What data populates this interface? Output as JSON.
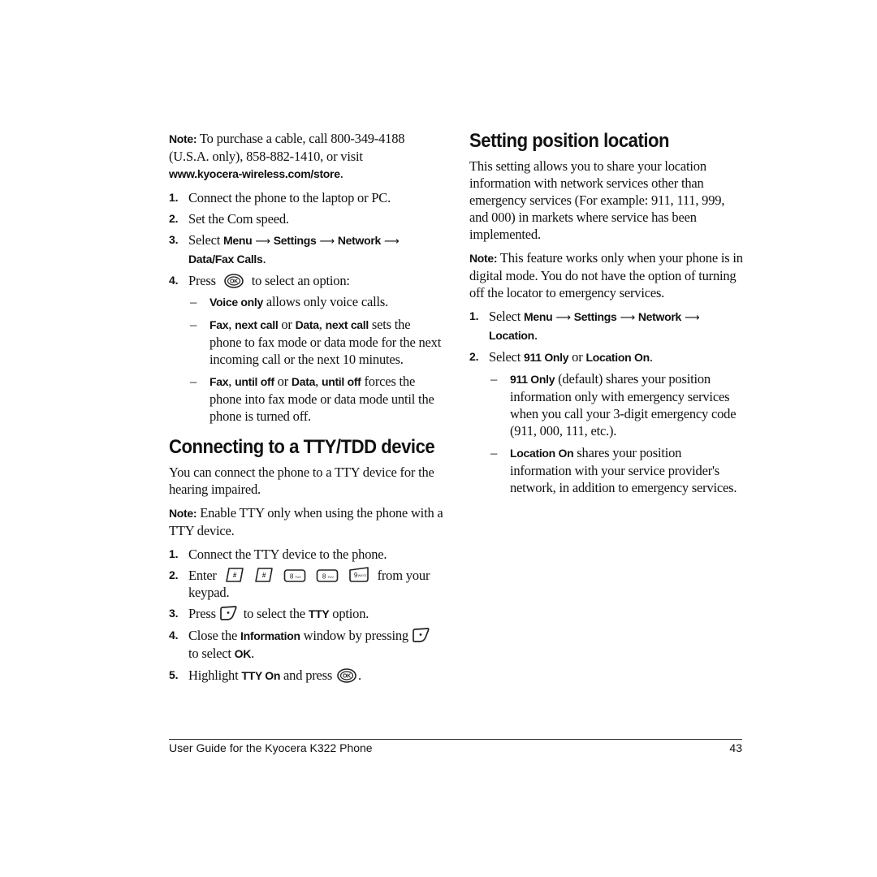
{
  "left": {
    "note1": {
      "label": "Note:",
      "text1": " To purchase a cable, call 800-349-4188 (U.S.A. only), 858-882-1410, or visit ",
      "url": "www.kyocera-wireless.com/store",
      "end": "."
    },
    "steps1": [
      {
        "num": "1.",
        "text": "Connect the phone to the laptop or PC."
      },
      {
        "num": "2.",
        "text": "Set the Com speed."
      },
      {
        "num": "3.",
        "pre": "Select ",
        "menu": "Menu",
        "settings": "Settings",
        "network": "Network",
        "last": "Data/Fax Calls",
        "end": "."
      },
      {
        "num": "4.",
        "pre": "Press ",
        "post": " to select an option:"
      }
    ],
    "options": [
      {
        "b1": "Voice only",
        "t1": " allows only voice calls."
      },
      {
        "b1": "Fax",
        "t1": ", ",
        "b2": "next call",
        "t2": " or ",
        "b3": "Data",
        "t3": ", ",
        "b4": "next call",
        "t4": " sets the phone to fax mode or data mode for the next incoming call or the next 10 minutes."
      },
      {
        "b1": "Fax",
        "t1": ", ",
        "b2": "until off",
        "t2": " or ",
        "b3": "Data",
        "t3": ", ",
        "b4": "until off",
        "t4": " forces the phone into fax mode or data mode until the phone is turned off."
      }
    ],
    "heading": "Connecting to a TTY/TDD device",
    "intro": "You can connect the phone to a TTY device for the hearing impaired.",
    "note2": {
      "label": "Note:",
      "text": " Enable TTY only when using the phone with a TTY device."
    },
    "steps2": [
      {
        "num": "1.",
        "text": "Connect the TTY device to the phone."
      },
      {
        "num": "2.",
        "pre": "Enter",
        "post": " from your keypad."
      },
      {
        "num": "3.",
        "pre": "Press ",
        "mid": " to select the ",
        "bold": "TTY",
        "post": " option."
      },
      {
        "num": "4.",
        "pre": "Close the ",
        "bold": "Information",
        "mid": " window by pressing ",
        "post": " to select ",
        "bold2": "OK",
        "end": "."
      },
      {
        "num": "5.",
        "pre": "Highlight ",
        "bold": "TTY On",
        "post": " and press ",
        "end": "."
      }
    ],
    "keys": [
      {
        "icon": "pound-key-icon",
        "label": "#",
        "sub": "⌂"
      },
      {
        "icon": "pound-key-icon",
        "label": "#",
        "sub": "⌂"
      },
      {
        "icon": "8-tuv-key-icon",
        "label": "8",
        "sub": "TUV"
      },
      {
        "icon": "8-tuv-key-icon",
        "label": "8",
        "sub": "TUV"
      },
      {
        "icon": "9-wxyz-key-icon",
        "label": "9",
        "sub": "WXYZ"
      }
    ],
    "ok_label": "OK"
  },
  "right": {
    "heading": "Setting position location",
    "intro": "This setting allows you to share your location information with network services other than emergency services (For example: 911, 111, 999, and 000) in markets where service has been implemented.",
    "note": {
      "label": "Note:",
      "text": " This feature works only when your phone is in digital mode. You do not have the option of turning off the locator to emergency services."
    },
    "steps": [
      {
        "num": "1.",
        "pre": "Select ",
        "menu": "Menu",
        "settings": "Settings",
        "network": "Network",
        "last": "Location",
        "end": "."
      },
      {
        "num": "2.",
        "pre": "Select ",
        "b1": "911 Only",
        "mid": " or ",
        "b2": "Location On",
        "end": "."
      }
    ],
    "options": [
      {
        "bold": "911 Only",
        "text": " (default) shares your position information only with emergency services when you call your 3-digit emergency code (911, 000, 111, etc.)."
      },
      {
        "bold": "Location On",
        "text": " shares your position information with your service provider's network, in addition to emergency services."
      }
    ]
  },
  "symbols": {
    "arrow": "⟶",
    "dash": "–"
  },
  "footer": {
    "title": "User Guide for the Kyocera K322 Phone",
    "page": "43"
  }
}
